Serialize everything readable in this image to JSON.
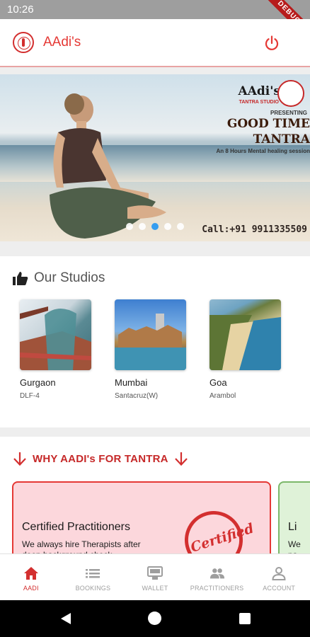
{
  "status_bar": {
    "time": "10:26",
    "debug_label": "DEBUG"
  },
  "app_bar": {
    "title": "AAdi's",
    "logo_icon": "lotus-logo-icon",
    "power_icon": "power-icon"
  },
  "banner": {
    "brand_name": "AAdi's",
    "brand_sub": "TANTRA STUDIO",
    "presenting": "PRESENTING",
    "headline_line1": "GOOD TIME",
    "headline_line2": "TANTRA",
    "subline": "An 8 Hours Mental healing session",
    "call": "Call:+91 9911335509",
    "carousel_count": 5,
    "carousel_active_index": 2
  },
  "studios": {
    "title": "Our Studios",
    "icon": "thumbs-up-icon",
    "items": [
      {
        "name": "Gurgaon",
        "location": "DLF-4"
      },
      {
        "name": "Mumbai",
        "location": "Santacruz(W)"
      },
      {
        "name": "Goa",
        "location": "Arambol"
      }
    ]
  },
  "why": {
    "title": "WHY AADI's FOR TANTRA",
    "icon": "arrow-down-icon",
    "card1": {
      "title": "Certified Practitioners",
      "text": "We always hire Therapists after deep background check",
      "stamp": "Certified"
    },
    "card2": {
      "title": "Li",
      "text_line1": "We",
      "text_line2": "pa"
    }
  },
  "bottom_nav": {
    "items": [
      {
        "label": "AADI",
        "icon": "home-icon"
      },
      {
        "label": "BOOKINGS",
        "icon": "list-icon"
      },
      {
        "label": "WALLET",
        "icon": "wallet-icon"
      },
      {
        "label": "PRACTITIONERS",
        "icon": "people-icon"
      },
      {
        "label": "ACCOUNT",
        "icon": "person-icon"
      }
    ],
    "active_index": 0
  },
  "colors": {
    "accent": "#e53935",
    "active_dot": "#2196f3",
    "card_pink": "#fcd7dc",
    "card_green": "#dff2d8"
  }
}
